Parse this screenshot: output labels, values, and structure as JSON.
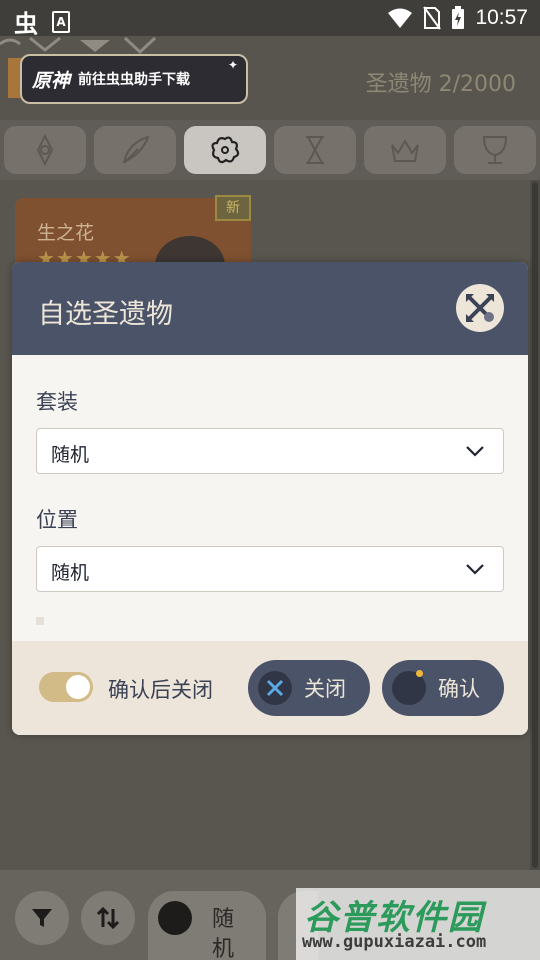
{
  "status_bar": {
    "app_glyph": "虫",
    "a_icon": "A",
    "time": "10:57",
    "icons": [
      "wifi-icon",
      "no-sim-icon",
      "battery-icon"
    ]
  },
  "header": {
    "banner_logo": "原神",
    "banner_text": "前往虫虫助手下载",
    "artifact_count": "圣遗物 2/2000"
  },
  "tabs": [
    {
      "icon": "all-artifacts-icon",
      "active": false
    },
    {
      "icon": "plume-icon",
      "active": false
    },
    {
      "icon": "flower-icon",
      "active": true
    },
    {
      "icon": "sands-icon",
      "active": false
    },
    {
      "icon": "circlet-icon",
      "active": false
    },
    {
      "icon": "goblet-icon",
      "active": false
    }
  ],
  "card": {
    "name": "生之花",
    "stars": "★★★★★",
    "badge": "新"
  },
  "modal": {
    "title": "自选圣遗物",
    "set_label": "套装",
    "set_value": "随机",
    "position_label": "位置",
    "position_value": "随机",
    "toggle_label": "确认后关闭",
    "toggle_on": true,
    "close_button": "关闭",
    "confirm_button": "确认"
  },
  "bottom_bar": {
    "random_label": "随机"
  },
  "watermark": {
    "title": "谷普软件园",
    "url": "www.gupuxiazai.com"
  },
  "colors": {
    "modal_header": "#4a5368",
    "modal_text": "#3b4255",
    "toggle_on": "#d3bb87",
    "footer_bg": "#ede5d9"
  }
}
